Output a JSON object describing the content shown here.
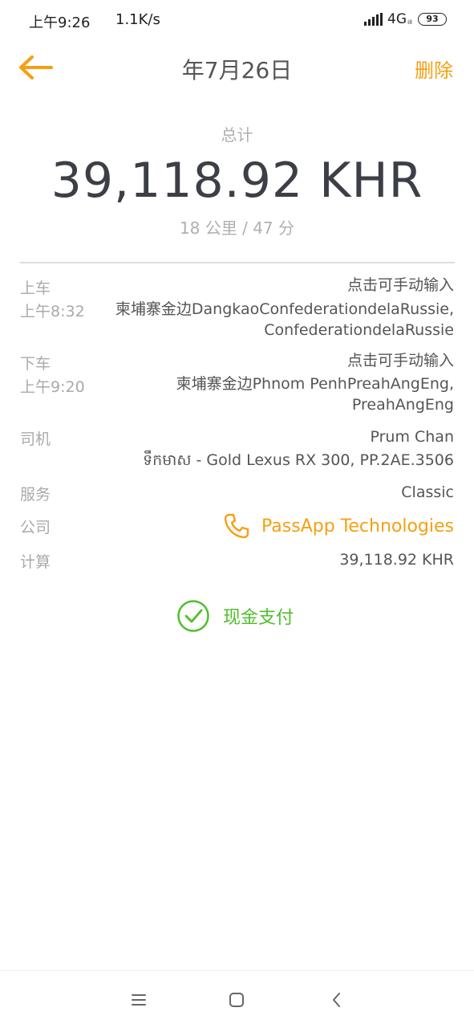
{
  "status_bar": {
    "time": "上午9:26",
    "speed": "1.1K/s",
    "network": "4G",
    "network_sub": "ill",
    "battery": "93"
  },
  "header": {
    "title": "年7月26日",
    "delete_label": "删除"
  },
  "summary": {
    "total_label": "总计",
    "total_amount": "39,118.92 KHR",
    "distance_time": "18 公里 / 47 分"
  },
  "pickup": {
    "label": "上车",
    "time": "上午8:32",
    "manual_input": "点击可手动输入",
    "address_line1": "柬埔寨金边DangkaoConfederationdelaRussie,",
    "address_line2": "ConfederationdelaRussie"
  },
  "dropoff": {
    "label": "下车",
    "time": "上午9:20",
    "manual_input": "点击可手动输入",
    "address_line1": "柬埔寨金边Phnom PenhPreahAngEng,",
    "address_line2": "PreahAngEng"
  },
  "driver": {
    "label": "司机",
    "name": "Prum Chan",
    "vehicle": "ទឹកមាស - Gold Lexus RX 300, PP.2AE.3506"
  },
  "service": {
    "label": "服务",
    "value": "Classic"
  },
  "company": {
    "label": "公司",
    "name": "PassApp Technologies",
    "icon": "phone-icon"
  },
  "calculation": {
    "label": "计算",
    "value": "39,118.92 KHR"
  },
  "payment": {
    "label": "现金支付",
    "icon": "check-circle-icon"
  },
  "colors": {
    "accent": "#f5a013",
    "success": "#4fbf2b",
    "amount": "#3d3f47",
    "muted": "#aaaaaa"
  }
}
